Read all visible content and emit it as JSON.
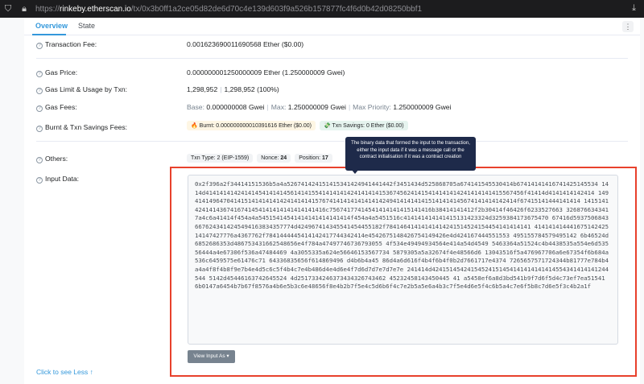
{
  "browser": {
    "url_prefix": "https://",
    "url_host": "rinkeby.etherscan.io",
    "url_path": "/tx/0x3b0ff1a2ce05d82de6d70c4e139d603f9a526b157877fc4f6d0b42d08250bbf1"
  },
  "tabs": {
    "overview": "Overview",
    "state": "State"
  },
  "rows": {
    "tx_fee": {
      "label": "Transaction Fee:",
      "value": "0.001623690011690568 Ether ($0.00)"
    },
    "gas_price": {
      "label": "Gas Price:",
      "value": "0.000000001250000009 Ether (1.250000009 Gwei)"
    },
    "gas_limit": {
      "label": "Gas Limit & Usage by Txn:",
      "limit": "1,298,952",
      "usage": "1,298,952 (100%)"
    },
    "gas_fees": {
      "label": "Gas Fees:",
      "base_label": "Base:",
      "base": "0.000000008 Gwei",
      "max_label": "Max:",
      "max": "1.250000009 Gwei",
      "prio_label": "Max Priority:",
      "prio": "1.250000009 Gwei"
    },
    "burnt": {
      "label": "Burnt & Txn Savings Fees:",
      "burnt": "🔥 Burnt: 0.000000000010391616 Ether ($0.00)",
      "savings": "💸 Txn Savings: 0 Ether ($0.00)"
    },
    "others": {
      "label": "Others:",
      "txn_type": "Txn Type: 2 (EIP-1559)",
      "nonce_label": "Nonce:",
      "nonce": "24",
      "position_label": "Position:",
      "position": "17"
    },
    "input": {
      "label": "Input Data:"
    }
  },
  "tooltip": "The binary data that formed the input to the transaction, either the input data if it was a message call or the contract initialisation if it was a contract creation",
  "input_data": "0x2f396a2f34414151536b5a4a526741424151415341424941441442f3451434d525868705a674141545530414b67414141416741425145534 1414d414141414241414541414145614141554141414142414141415367456241415414141414241414141415567456f41414d4141414142414 1494141496470414151414141414241414141576741414141414141424941414141415141414145674141414142414f67415141444141414 14151414241414367416741454141414141414141416c75674177414541414141415141416b38414141412f2b30414f46426f6233527663 3268766343417a4c6a41414f454a4a54515414541414141414141414f454a4a5451516c414141414141415131423324d3259384173675470 67416d59375068436676243414245494163834357774d424967414345541454455182f78414641414141414241514524154454141414141 41414141444167514242514147427776a4367762f7841444445414142417744342414e4542675148426754149426e4d424167444551553 495155784579495142 6b46524d6852686353d486753431662548656e4f784a47497746736793055 4f534e49494934564e414a54d4549 5463364a51524c4b4438535a554e6d53556444a4e67306f536a47484469 4a3055335a624e56646153567734 5879305a5a32674f4e48566d6 13043516f5a476967706a6e67354f6b684a536c6459575e61476c71 64336835656f614869496 d4b6b4a45 86d4a6d616f4b4f6b4f0b2d7661717e4374 7265657571724344b81777e784b4a4a4f8f4b8f9e7b4e4d5c6c5f4b4c7e4b486d4e4d6e4f7d6d7d7e7d7e7e 241414d42415145424154524151454141414141414554341414141244544  5142d45446163742645524 4d2517334246373434326743462  45232458143450445 41 a5458ef6a8d3bd541b9f7d6f5d4c73ef7ea51541 6b0147a6454b7b67f8576a4b6e5b3c6e48656f8e4b2b7f5e4c5d6b6f4c7e2b5a5e6a4b3c7f5e4d6e5f4c6b5a4c7e6f5b8c7d6e5f3c4b2a1f",
  "view_button": "View Input As",
  "see_less": "Click to see Less"
}
